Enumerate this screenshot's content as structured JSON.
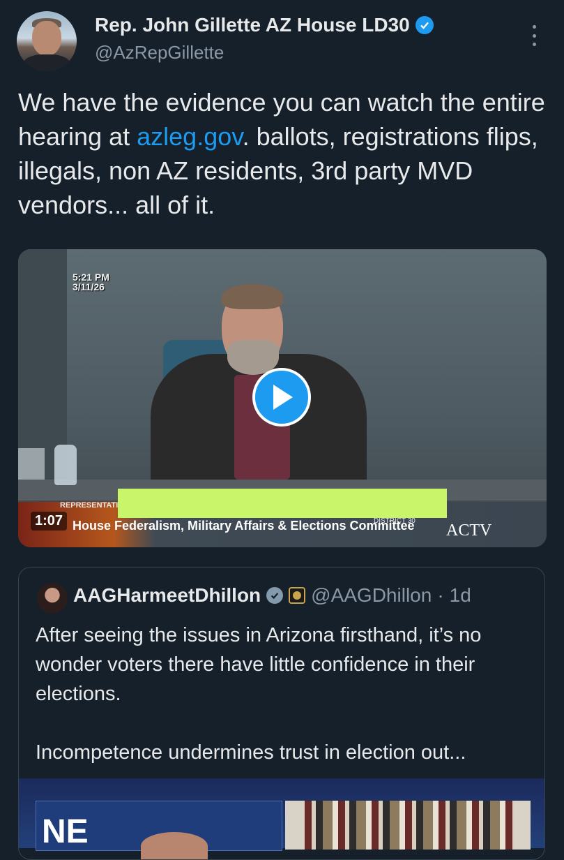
{
  "tweet": {
    "display_name": "Rep. John Gillette AZ House LD30",
    "handle": "@AzRepGillette",
    "text_before_link": "We have the evidence you can watch the entire hearing at ",
    "link_text": "azleg.gov",
    "text_after_link": ".   ballots, registrations flips,  illegals,  non AZ residents, 3rd party MVD vendors... all of it.",
    "video": {
      "timestamp_time": "5:21 PM",
      "timestamp_date": "3/11/26",
      "duration": "1:07",
      "lower_third_label": "REPRESENTATIV",
      "committee_text": "House Federalism, Military Affairs & Elections Committee",
      "district_text": "DISTRICT 30",
      "network_logo": "ACTV"
    }
  },
  "quoted_tweet": {
    "display_name": "AAGHarmeetDhillon",
    "handle": "@AAGDhillon",
    "separator": "·",
    "age": "1d",
    "text_line1": "After seeing the issues in Arizona firsthand, it’s no wonder voters there have little confidence in their elections.",
    "text_line2": "Incompetence undermines trust in election out...",
    "media_left_text": "NE"
  },
  "colors": {
    "background": "#15202b",
    "text_primary": "#e7e9ea",
    "text_secondary": "#8b98a5",
    "accent": "#1d9bf0",
    "border": "#38444d",
    "redaction": "#c8f56a"
  },
  "icons": {
    "verified": "verified-badge-icon",
    "more": "more-options-icon",
    "play": "play-icon",
    "gov_seal": "government-affiliation-icon"
  }
}
